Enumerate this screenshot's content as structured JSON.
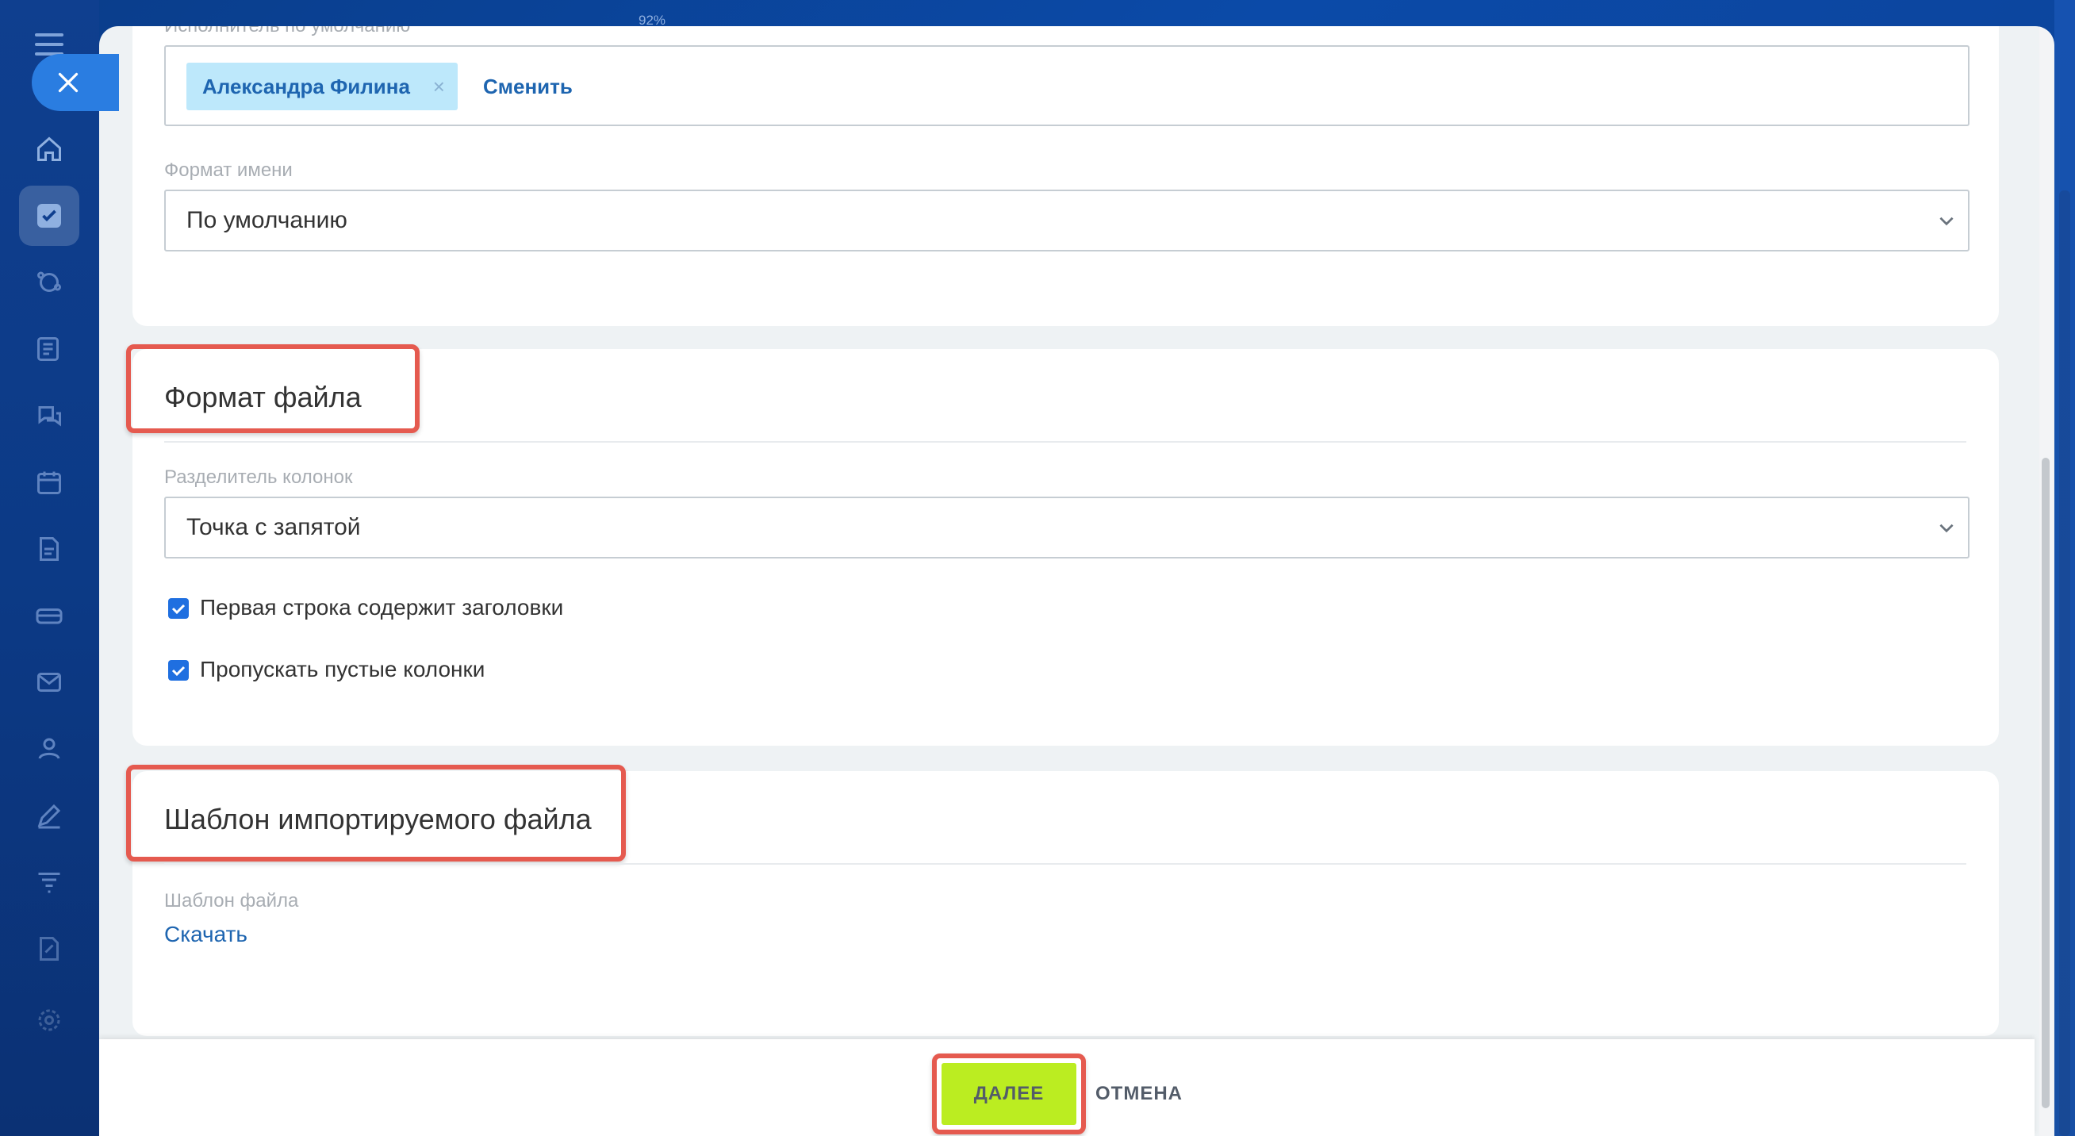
{
  "top_zoom_text": "92%",
  "sidebar": {
    "items": [
      {
        "icon": "home-icon"
      },
      {
        "icon": "tasks-icon",
        "active": true
      },
      {
        "icon": "crm-icon"
      },
      {
        "icon": "feed-icon"
      },
      {
        "icon": "chat-icon"
      },
      {
        "icon": "calendar-icon"
      },
      {
        "icon": "document-icon"
      },
      {
        "icon": "drive-icon"
      },
      {
        "icon": "mail-icon"
      },
      {
        "icon": "contacts-icon"
      },
      {
        "icon": "sign-icon"
      },
      {
        "icon": "filter-icon"
      },
      {
        "icon": "edit-doc-icon"
      },
      {
        "icon": "settings-icon"
      }
    ]
  },
  "card1": {
    "assignee_label": "Исполнитель по умолчанию",
    "assignee_name": "Александра Филина",
    "assignee_remove": "×",
    "change_label": "Сменить",
    "name_format_label": "Формат имени",
    "name_format_value": "По умолчанию"
  },
  "card2": {
    "title": "Формат файла",
    "separator_label": "Разделитель колонок",
    "separator_value": "Точка с запятой",
    "checkboxes": [
      {
        "label": "Первая строка содержит заголовки",
        "checked": true
      },
      {
        "label": "Пропускать пустые колонки",
        "checked": true
      }
    ]
  },
  "card3": {
    "title": "Шаблон импортируемого файла",
    "template_label": "Шаблон файла",
    "download_label": "Скачать"
  },
  "footer": {
    "next_label": "ДАЛЕЕ",
    "cancel_label": "ОТМЕНА"
  },
  "colors": {
    "accent_link": "#1e65b0",
    "next_button": "#bbed21",
    "highlight": "#e55a4f",
    "checkbox": "#1f6fe0"
  }
}
